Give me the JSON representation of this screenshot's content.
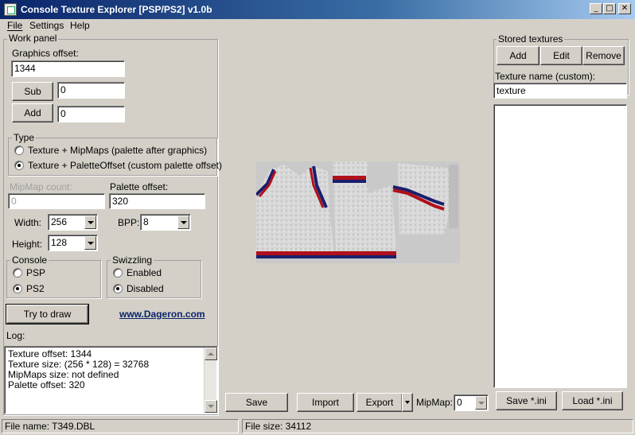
{
  "window": {
    "title": "Console Texture Explorer [PSP/PS2] v1.0b"
  },
  "menu": {
    "items": [
      {
        "label": "File",
        "accel": "F"
      },
      {
        "label": "Settings",
        "accel": "S"
      },
      {
        "label": "Help",
        "accel": "H"
      }
    ]
  },
  "work_panel": {
    "title": "Work panel",
    "graphics_offset_label": "Graphics offset:",
    "graphics_offset_value": "1344",
    "sub_label": "Sub",
    "sub_value": "0",
    "add_label": "Add",
    "add_value": "0",
    "type": {
      "title": "Type",
      "options": [
        "Texture + MipMaps (palette after graphics)",
        "Texture + PaletteOffset (custom palette offset)"
      ],
      "selected": 1
    },
    "mipmap_count_label": "MipMap count:",
    "mipmap_count_value": "0",
    "palette_offset_label": "Palette offset:",
    "palette_offset_value": "320",
    "width_label": "Width:",
    "width_value": "256",
    "bpp_label": "BPP:",
    "bpp_value": "8",
    "height_label": "Height:",
    "height_value": "128",
    "console": {
      "title": "Console",
      "options": [
        "PSP",
        "PS2"
      ],
      "selected": 1
    },
    "swizzling": {
      "title": "Swizzling",
      "options": [
        "Enabled",
        "Disabled"
      ],
      "selected": 1
    },
    "try_button": "Try to draw",
    "website": "www.Dageron.com",
    "log_label": "Log:",
    "log_lines": [
      "Texture offset: 1344",
      "Texture size: (256 * 128) = 32768",
      "MipMaps size: not defined",
      "Palette offset: 320"
    ]
  },
  "center": {
    "save_label": "Save",
    "import_label": "Import",
    "export_label": "Export",
    "mipmap_label": "MipMap:",
    "mipmap_value": "0"
  },
  "stored": {
    "title": "Stored textures",
    "add_label": "Add",
    "edit_label": "Edit",
    "remove_label": "Remove",
    "name_label": "Texture name (custom):",
    "name_value": "texture",
    "save_ini_label": "Save *.ini",
    "load_ini_label": "Load *.ini"
  },
  "status": {
    "file_name": "File name: T349.DBL",
    "file_size": "File size: 34112"
  },
  "colors": {
    "title_gradient_start": "#0a246a",
    "title_gradient_end": "#a6caf0",
    "face": "#d4d0c8",
    "link": "#0a246a"
  }
}
